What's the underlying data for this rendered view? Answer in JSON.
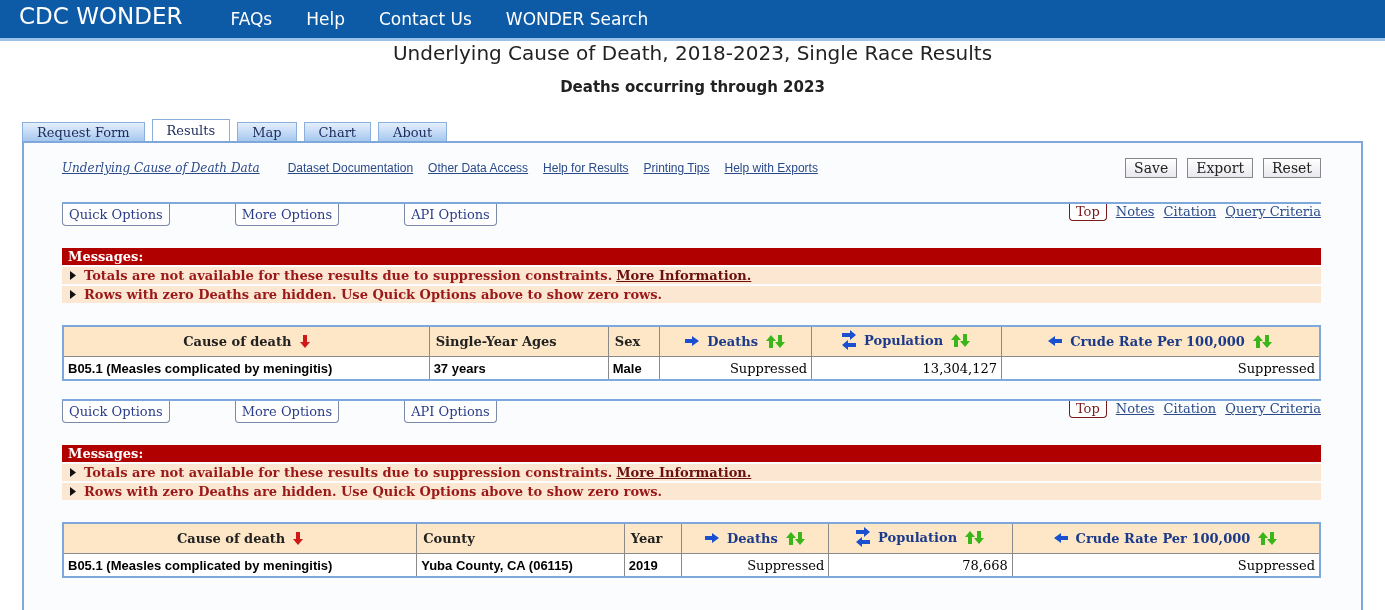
{
  "header": {
    "logo": "CDC WONDER",
    "nav": [
      "FAQs",
      "Help",
      "Contact Us",
      "WONDER Search"
    ]
  },
  "title": "Underlying Cause of Death, 2018-2023, Single Race Results",
  "subtitle": "Deaths occurring through 2023",
  "tabs": [
    {
      "label": "Request Form",
      "selected": false
    },
    {
      "label": "Results",
      "selected": true
    },
    {
      "label": "Map",
      "selected": false
    },
    {
      "label": "Chart",
      "selected": false
    },
    {
      "label": "About",
      "selected": false
    }
  ],
  "links": [
    {
      "label": "Underlying Cause of Death Data",
      "kind": "main"
    },
    {
      "label": "Dataset Documentation",
      "kind": "plain"
    },
    {
      "label": "Other Data Access",
      "kind": "plain"
    },
    {
      "label": "Help for Results",
      "kind": "plain"
    },
    {
      "label": "Printing Tips",
      "kind": "plain"
    },
    {
      "label": "Help with Exports",
      "kind": "plain"
    }
  ],
  "actions": [
    "Save",
    "Export",
    "Reset"
  ],
  "sections": [
    {
      "options": [
        "Quick Options",
        "More Options",
        "API Options"
      ],
      "nav": [
        {
          "label": "Top",
          "kind": "boxed"
        },
        {
          "label": "Notes",
          "kind": "link"
        },
        {
          "label": "Citation",
          "kind": "link"
        },
        {
          "label": "Query Criteria",
          "kind": "link"
        }
      ],
      "messages_title": "Messages:",
      "messages": [
        {
          "text": "Totals are not available for these results due to suppression constraints.",
          "link": "More Information."
        },
        {
          "text": "Rows with zero Deaths are hidden. Use Quick Options above to show zero rows."
        }
      ],
      "table": {
        "columns": [
          {
            "label": "Cause of death",
            "kind": "sorted"
          },
          {
            "label": "Single-Year Ages",
            "kind": "plain"
          },
          {
            "label": "Sex",
            "kind": "plain"
          },
          {
            "label": "Deaths",
            "kind": "measure-right"
          },
          {
            "label": "Population",
            "kind": "measure-swap"
          },
          {
            "label": "Crude Rate Per 100,000",
            "kind": "measure-left"
          }
        ],
        "rows": [
          [
            "B05.1 (Measles complicated by meningitis)",
            "37 years",
            "Male",
            "Suppressed",
            "13,304,127",
            "Suppressed"
          ]
        ]
      }
    },
    {
      "options": [
        "Quick Options",
        "More Options",
        "API Options"
      ],
      "nav": [
        {
          "label": "Top",
          "kind": "boxed"
        },
        {
          "label": "Notes",
          "kind": "link"
        },
        {
          "label": "Citation",
          "kind": "link"
        },
        {
          "label": "Query Criteria",
          "kind": "link"
        }
      ],
      "messages_title": "Messages:",
      "messages": [
        {
          "text": "Totals are not available for these results due to suppression constraints.",
          "link": "More Information."
        },
        {
          "text": "Rows with zero Deaths are hidden. Use Quick Options above to show zero rows."
        }
      ],
      "table": {
        "columns": [
          {
            "label": "Cause of death",
            "kind": "sorted"
          },
          {
            "label": "County",
            "kind": "plain"
          },
          {
            "label": "Year",
            "kind": "plain"
          },
          {
            "label": "Deaths",
            "kind": "measure-right"
          },
          {
            "label": "Population",
            "kind": "measure-swap"
          },
          {
            "label": "Crude Rate Per 100,000",
            "kind": "measure-left"
          }
        ],
        "rows": [
          [
            "B05.1 (Measles complicated by meningitis)",
            "Yuba County, CA (06115)",
            "2019",
            "Suppressed",
            "78,668",
            "Suppressed"
          ]
        ]
      }
    }
  ]
}
